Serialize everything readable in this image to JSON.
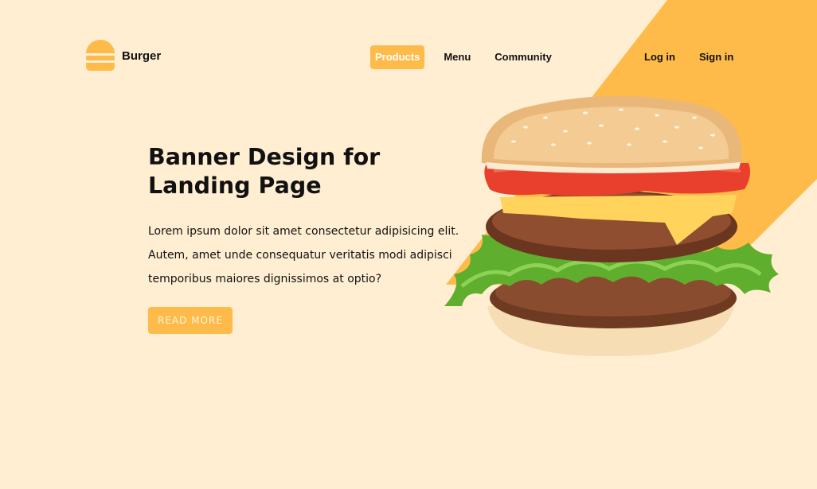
{
  "brand": {
    "name": "Burger",
    "icon": "burger-icon"
  },
  "nav": {
    "items": [
      "Products",
      "Menu",
      "Community"
    ],
    "active": "Products"
  },
  "auth": {
    "login_label": "Log in",
    "signin_label": "Sign in"
  },
  "hero": {
    "title_line1": "Banner Design for",
    "title_line2": "Landing Page",
    "text": "Lorem ipsum dolor sit amet consectetur adipisicing elit. Autem, amet unde consequatur veritatis modi adipisci temporibus maiores dignissimos at optio?",
    "button_label": "READ MORE"
  },
  "colors": {
    "background": "#FFEED1",
    "accent": "#FFBB4A",
    "text": "#111111"
  }
}
